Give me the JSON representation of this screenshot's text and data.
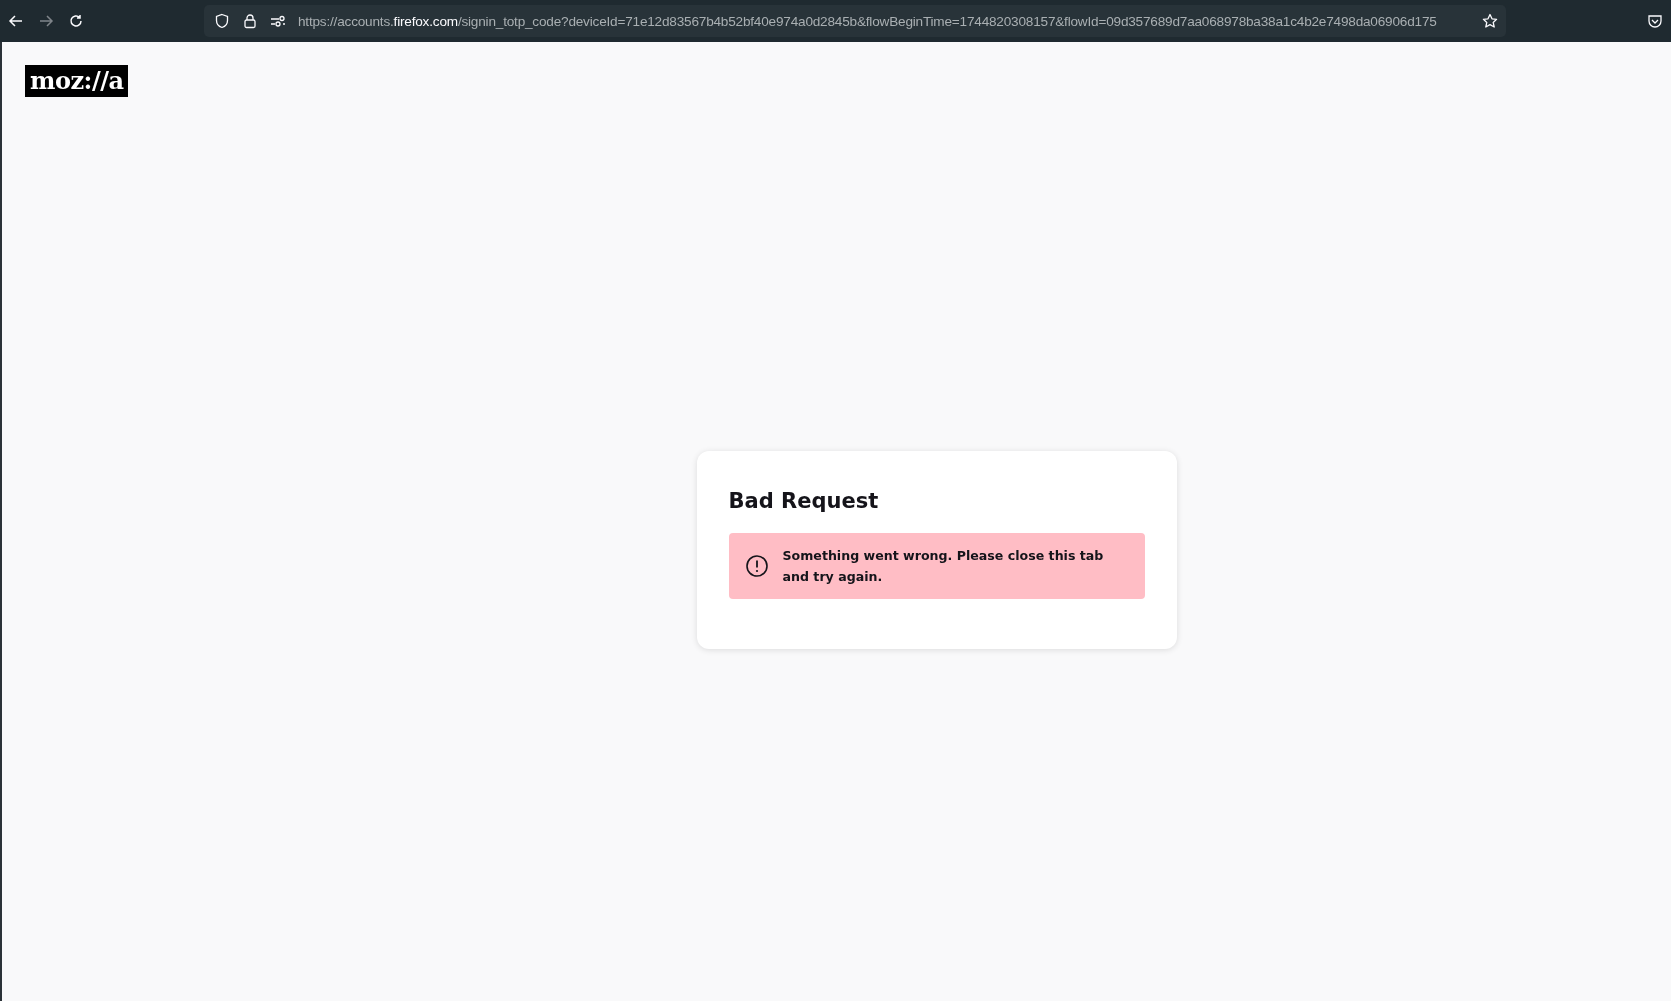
{
  "toolbar": {
    "back_disabled": false,
    "forward_disabled": true,
    "url": {
      "scheme": "https://accounts.",
      "domain": "firefox.com",
      "path": "/signin_totp_code?deviceId=71e12d83567b4b52bf40e974a0d2845b&flowBeginTime=1744820308157&flowId=09d357689d7aa068978ba38a1c4b2e7498da06906d175"
    }
  },
  "logo": {
    "text": "moz://a"
  },
  "card": {
    "title": "Bad Request",
    "alert": {
      "kind": "error",
      "message": "Something went wrong. Please close this tab and try again."
    }
  }
}
